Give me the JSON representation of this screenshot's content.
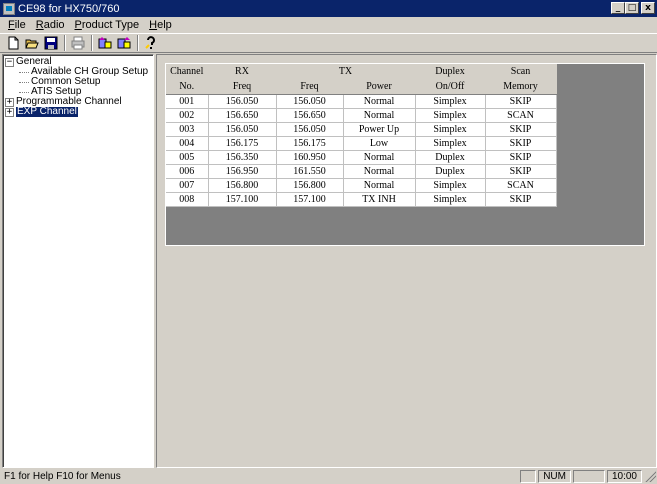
{
  "window": {
    "title": "CE98 for HX750/760",
    "minimize": "_",
    "maximize": "□",
    "close": "x"
  },
  "menu": [
    {
      "key": "F",
      "rest": "ile"
    },
    {
      "key": "R",
      "rest": "adio"
    },
    {
      "key": "P",
      "rest": "roduct Type"
    },
    {
      "key": "H",
      "rest": "elp"
    }
  ],
  "toolbar": {
    "icons": [
      "new-icon",
      "open-icon",
      "save-icon",
      "print-icon",
      "read-radio-icon",
      "write-radio-icon",
      "help-icon"
    ]
  },
  "tree": {
    "general": "General",
    "general_toggle": "−",
    "children": [
      "Available CH Group Setup",
      "Common Setup",
      "ATIS Setup"
    ],
    "programmable": "Programmable Channel",
    "programmable_toggle": "+",
    "exp": "EXP Channel",
    "exp_toggle": "+"
  },
  "grid": {
    "header1": [
      "Channel",
      "RX",
      "TX",
      "Duplex",
      "Scan"
    ],
    "header2": [
      "No.",
      "Freq",
      "Freq",
      "Power",
      "On/Off",
      "Memory"
    ],
    "rows": [
      [
        "001",
        "156.050",
        "156.050",
        "Normal",
        "Simplex",
        "SKIP"
      ],
      [
        "002",
        "156.650",
        "156.650",
        "Normal",
        "Simplex",
        "SCAN"
      ],
      [
        "003",
        "156.050",
        "156.050",
        "Power Up",
        "Simplex",
        "SKIP"
      ],
      [
        "004",
        "156.175",
        "156.175",
        "Low",
        "Simplex",
        "SKIP"
      ],
      [
        "005",
        "156.350",
        "160.950",
        "Normal",
        "Duplex",
        "SKIP"
      ],
      [
        "006",
        "156.950",
        "161.550",
        "Normal",
        "Duplex",
        "SKIP"
      ],
      [
        "007",
        "156.800",
        "156.800",
        "Normal",
        "Simplex",
        "SCAN"
      ],
      [
        "008",
        "157.100",
        "157.100",
        "TX INH",
        "Simplex",
        "SKIP"
      ]
    ]
  },
  "status": {
    "help_text": "F1 for Help   F10 for Menus",
    "num": "NUM",
    "time": "10:00"
  }
}
